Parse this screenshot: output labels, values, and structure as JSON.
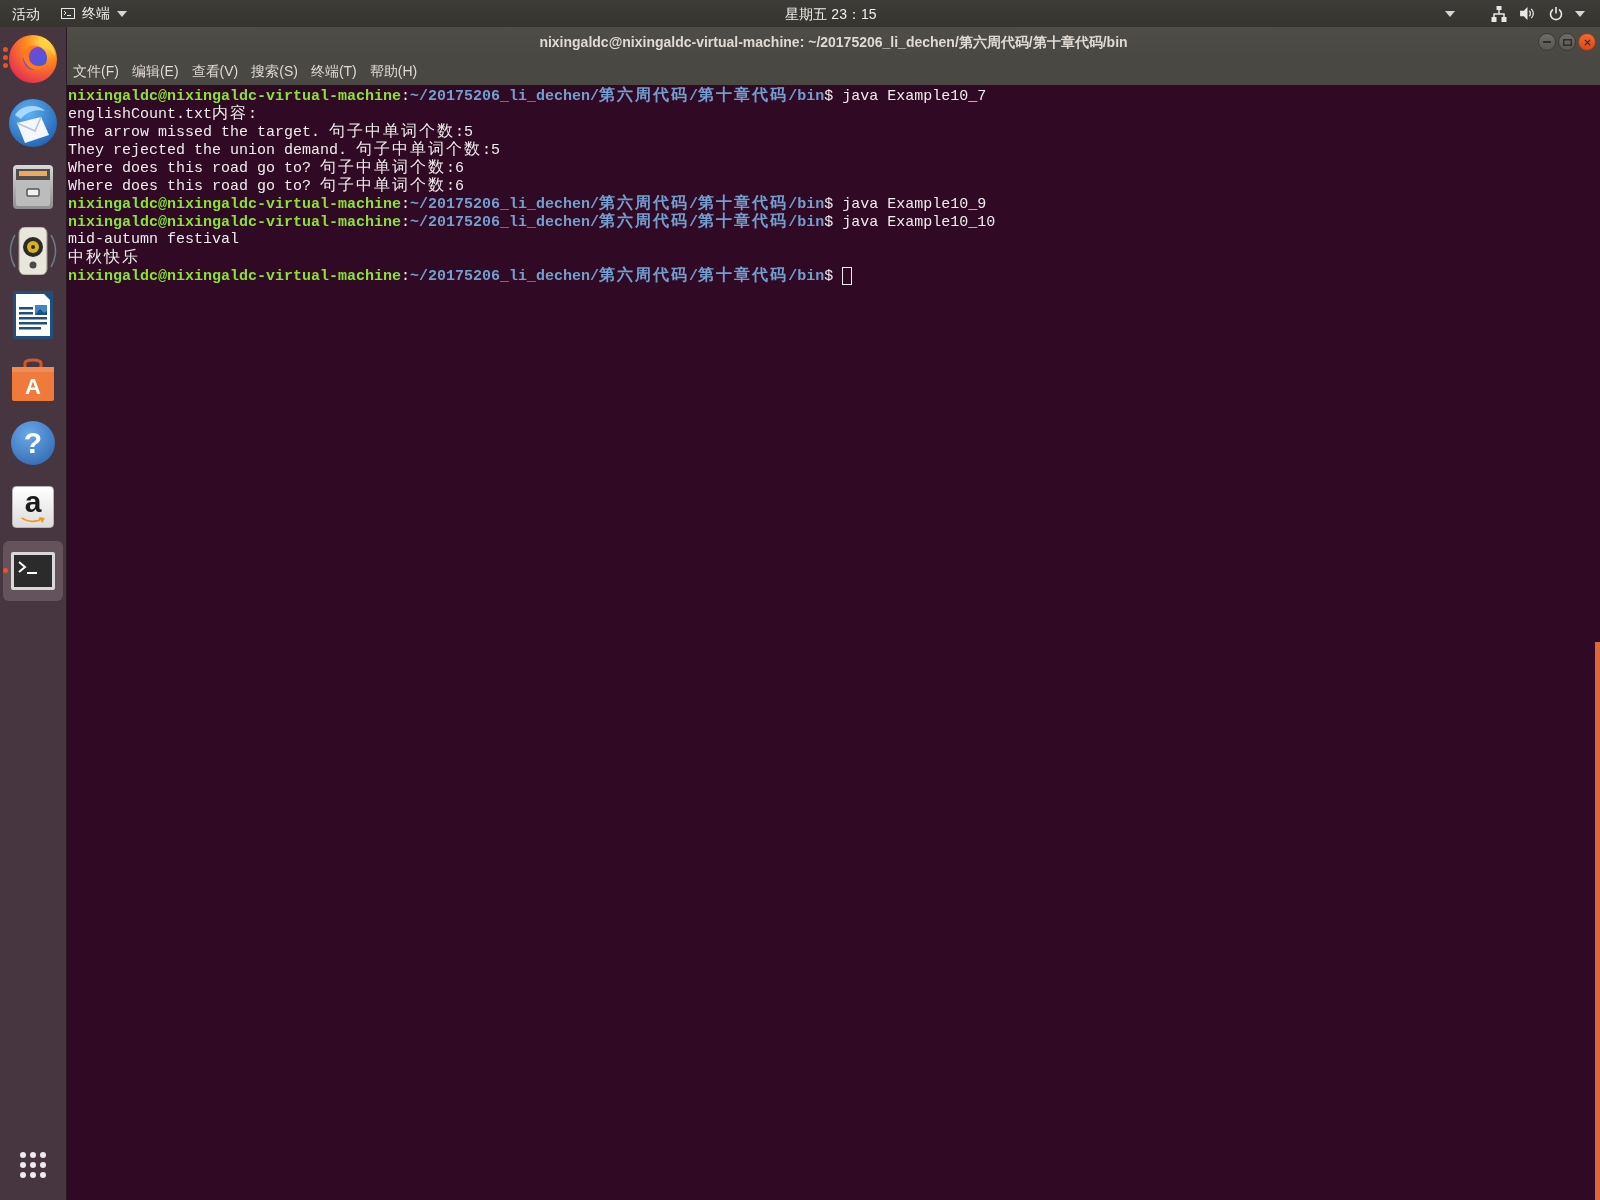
{
  "top_bar": {
    "activities": "活动",
    "app_menu": "终端",
    "clock": "星期五 23：15"
  },
  "dock": {
    "items": [
      {
        "kind": "browser",
        "selected": false,
        "running": true,
        "multiple_windows": true
      },
      {
        "kind": "mail",
        "selected": false,
        "running": false
      },
      {
        "kind": "files",
        "selected": false,
        "running": false
      },
      {
        "kind": "music",
        "selected": false,
        "running": false
      },
      {
        "kind": "document",
        "selected": false,
        "running": false
      },
      {
        "kind": "store",
        "selected": false,
        "running": false,
        "glyph": "A"
      },
      {
        "kind": "help",
        "selected": false,
        "running": false,
        "glyph": "?"
      },
      {
        "kind": "shopping",
        "selected": false,
        "running": false,
        "glyph": "a"
      },
      {
        "kind": "terminal",
        "selected": true,
        "running": true,
        "multiple_windows": false
      }
    ]
  },
  "window": {
    "title": "nixingaldc@nixingaldc-virtual-machine: ~/20175206_li_dechen/第六周代码/第十章代码/bin",
    "menu": [
      "文件(F)",
      "编辑(E)",
      "查看(V)",
      "搜索(S)",
      "终端(T)",
      "帮助(H)"
    ]
  },
  "terminal": {
    "lines": [
      {
        "kind": "prompt",
        "user_host": "nixingaldc@nixingaldc-virtual-machine",
        "separator": ":",
        "path": "~/20175206_li_dechen/第六周代码/第十章代码/bin",
        "symbol": "$",
        "command": "java Example10_7",
        "cursor": false
      },
      {
        "kind": "output",
        "text": "englishCount.txt内容:"
      },
      {
        "kind": "output",
        "text": "The arrow missed the target. 句子中单词个数:5"
      },
      {
        "kind": "output",
        "text": "They rejected the union demand. 句子中单词个数:5"
      },
      {
        "kind": "output",
        "text": "Where does this road go to? 句子中单词个数:6"
      },
      {
        "kind": "output",
        "text": "Where does this road go to? 句子中单词个数:6"
      },
      {
        "kind": "prompt",
        "user_host": "nixingaldc@nixingaldc-virtual-machine",
        "separator": ":",
        "path": "~/20175206_li_dechen/第六周代码/第十章代码/bin",
        "symbol": "$",
        "command": "java Example10_9",
        "cursor": false
      },
      {
        "kind": "prompt",
        "user_host": "nixingaldc@nixingaldc-virtual-machine",
        "separator": ":",
        "path": "~/20175206_li_dechen/第六周代码/第十章代码/bin",
        "symbol": "$",
        "command": "java Example10_10",
        "cursor": false
      },
      {
        "kind": "output",
        "text": "mid-autumn festival"
      },
      {
        "kind": "output",
        "text": "中秋快乐"
      },
      {
        "kind": "prompt",
        "user_host": "nixingaldc@nixingaldc-virtual-machine",
        "separator": ":",
        "path": "~/20175206_li_dechen/第六周代码/第十章代码/bin",
        "symbol": "$",
        "cursor": true
      }
    ]
  }
}
